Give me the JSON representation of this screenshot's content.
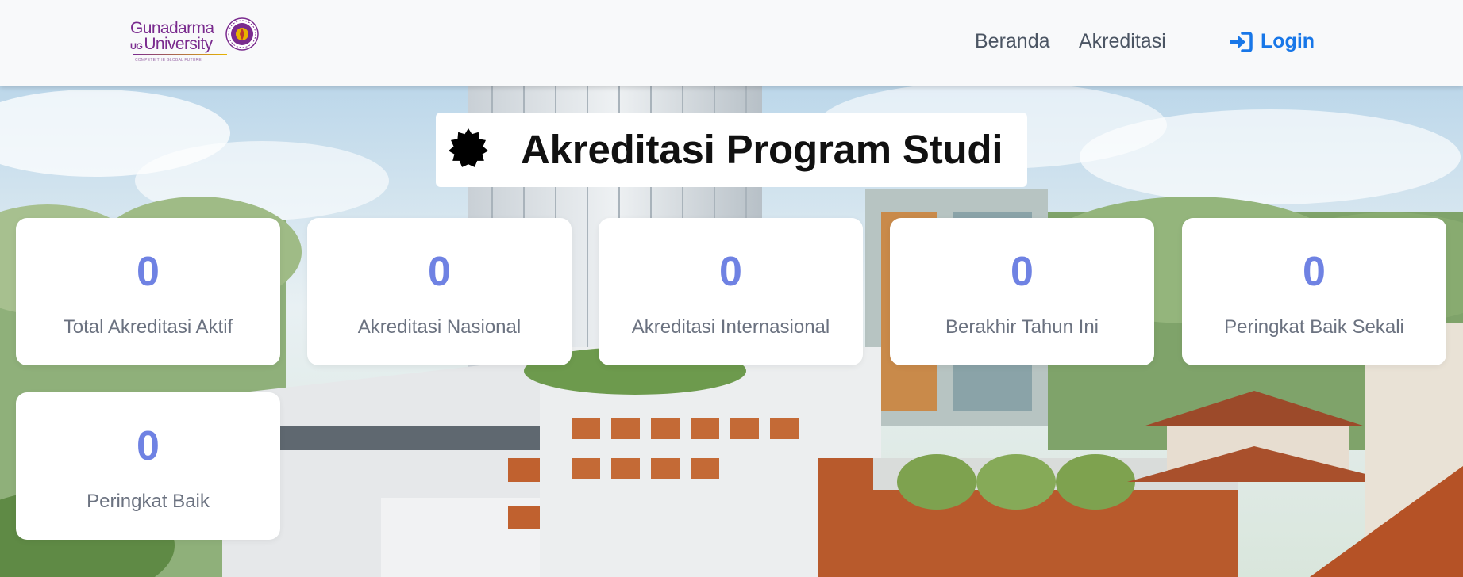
{
  "navbar": {
    "logo": {
      "line1": "Gunadarma",
      "badge": "UG",
      "line2": "University",
      "tagline": "COMPETE THE GLOBAL FUTURE"
    },
    "links": {
      "beranda": "Beranda",
      "akreditasi": "Akreditasi"
    },
    "login_label": "Login"
  },
  "page": {
    "title": "Akreditasi Program Studi"
  },
  "stats": [
    {
      "value": "0",
      "label": "Total Akreditasi Aktif"
    },
    {
      "value": "0",
      "label": "Akreditasi Nasional"
    },
    {
      "value": "0",
      "label": "Akreditasi Internasional"
    },
    {
      "value": "0",
      "label": "Berakhir Tahun Ini"
    },
    {
      "value": "0",
      "label": "Peringkat Baik Sekali"
    },
    {
      "value": "0",
      "label": "Peringkat Baik"
    }
  ],
  "colors": {
    "accent": "#6f82e3",
    "login": "#1877e8",
    "brand": "#7a2b8e"
  },
  "icons": {
    "login": "sign-in-icon",
    "title": "certificate-badge-icon"
  }
}
